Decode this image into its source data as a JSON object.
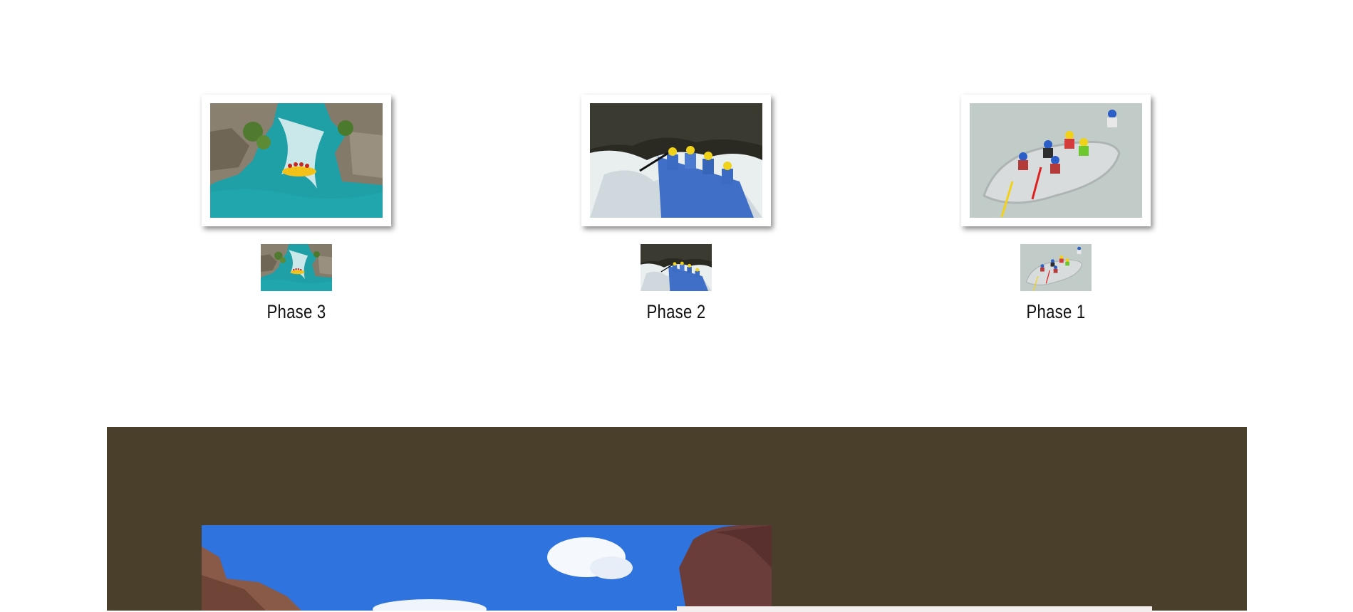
{
  "phases": [
    {
      "label": "Phase 3",
      "image": "canyon-rafting-photo",
      "thumbnail": "canyon-rafting-thumbnail"
    },
    {
      "label": "Phase 2",
      "image": "whitewater-raft-crew-photo",
      "thumbnail": "whitewater-raft-crew-thumbnail"
    },
    {
      "label": "Phase 1",
      "image": "raft-overhead-photo",
      "thumbnail": "raft-overhead-thumbnail"
    }
  ],
  "band": {
    "background_color": "#4a3f2a",
    "photo": "canyon-sky-photo"
  }
}
